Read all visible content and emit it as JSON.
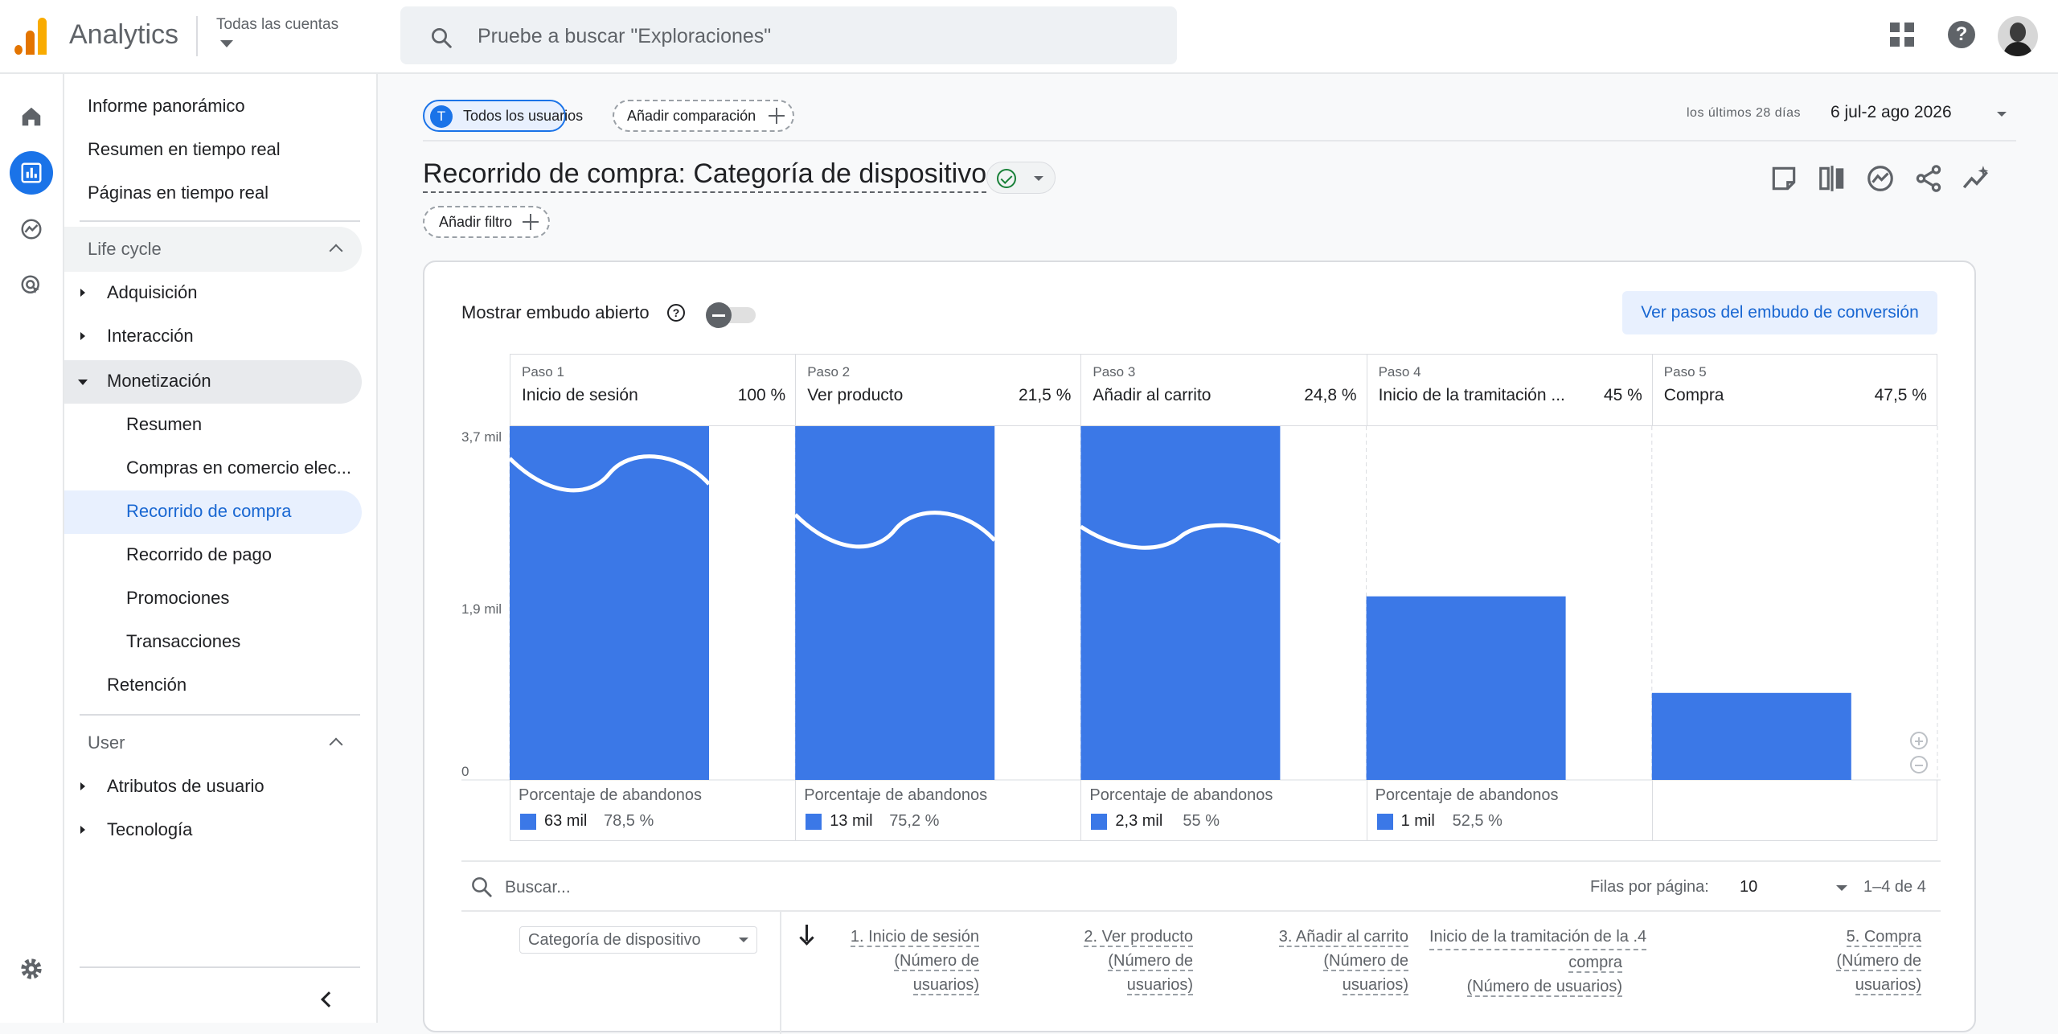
{
  "header": {
    "app_name": "Analytics",
    "account_label": "Todas las cuentas",
    "search_placeholder": "Pruebe a buscar \"Exploraciones\""
  },
  "nav": {
    "top_items": [
      "Informe panorámico",
      "Resumen en tiempo real",
      "Páginas en tiempo real"
    ],
    "lifecycle_title": "Life cycle",
    "lifecycle": {
      "acquisition": "Adquisición",
      "interaction": "Interacción",
      "monetization": "Monetización",
      "monetization_children": [
        "Resumen",
        "Compras en comercio elec...",
        "Recorrido de compra",
        "Recorrido de pago",
        "Promociones",
        "Transacciones"
      ],
      "retention": "Retención"
    },
    "user_title": "User",
    "user": {
      "attributes": "Atributos de usuario",
      "technology": "Tecnología"
    }
  },
  "toolbar": {
    "segment_initial": "T",
    "segment_label": "Todos los usuarios",
    "add_comparison": "Añadir comparación",
    "date_label": "los últimos 28 días",
    "date_range": "6 jul-2 ago 2026",
    "page_title": "Recorrido de compra: Categoría de dispositivo",
    "add_filter": "Añadir filtro"
  },
  "card": {
    "open_funnel_label": "Mostrar embudo abierto",
    "conversion_button": "Ver pasos del embudo de conversión",
    "dropoff_title": "Porcentaje de abandonos",
    "search_placeholder": "Buscar...",
    "rows_per_page_label": "Filas por página:",
    "rows_per_page_value": "10",
    "range_label": "1–4 de 4",
    "dimension_select": "Categoría de dispositivo",
    "columns": [
      {
        "line1": "1. Inicio de sesión",
        "line2": "(Número de",
        "line3": "usuarios)"
      },
      {
        "line1": "2. Ver producto",
        "line2": "(Número de",
        "line3": "usuarios)"
      },
      {
        "line1": "3. Añadir al carrito",
        "line2": "(Número de",
        "line3": "usuarios)"
      },
      {
        "line1": "4. Inicio de la tramitación de la",
        "line2": "compra",
        "line3": "(Número de usuarios)"
      },
      {
        "line1": "5. Compra",
        "line2": "(Número de",
        "line3": "usuarios)"
      }
    ]
  },
  "colors": {
    "accent": "#1a73e8",
    "bar": "#3b78e7",
    "selected_bg": "#e8f0fe"
  },
  "chart_data": {
    "type": "bar",
    "ylabel": "",
    "ylim": [
      0,
      3.7
    ],
    "yticks": [
      {
        "value": 0,
        "label": "0"
      },
      {
        "value": 1.9,
        "label": "1,9 mil"
      },
      {
        "value": 3.7,
        "label": "3,7 mil"
      }
    ],
    "steps": [
      {
        "step_label": "Paso 1",
        "name": "Inicio de sesión",
        "pct": "100 %",
        "value": 3.7,
        "drop_count": "63 mil",
        "drop_rate": "78,5 %",
        "truncated": true
      },
      {
        "step_label": "Paso 2",
        "name": "Ver producto",
        "pct": "21,5 %",
        "value": 3.7,
        "drop_count": "13 mil",
        "drop_rate": "75,2 %",
        "truncated": true
      },
      {
        "step_label": "Paso 3",
        "name": "Añadir al carrito",
        "pct": "24,8 %",
        "value": 3.7,
        "drop_count": "2,3 mil",
        "drop_rate": "55 %",
        "truncated": true
      },
      {
        "step_label": "Paso 4",
        "name": "Inicio de la tramitación ...",
        "pct": "45 %",
        "value": 1.92,
        "drop_count": "1 mil",
        "drop_rate": "52,5 %",
        "truncated": false
      },
      {
        "step_label": "Paso 5",
        "name": "Compra",
        "pct": "47,5 %",
        "value": 0.91,
        "drop_count": "",
        "drop_rate": "",
        "truncated": false
      }
    ]
  }
}
